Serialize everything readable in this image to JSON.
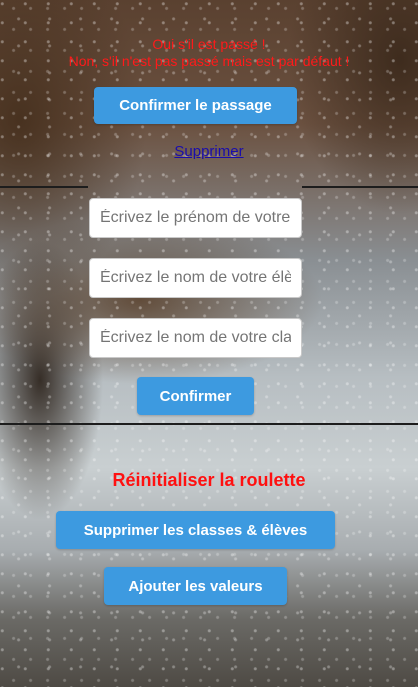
{
  "passage": {
    "notice_line1": "Oui s'il est passé !",
    "notice_line2": "Non, s'il n'est pas passé mais est par défaut !",
    "confirm_button": "Confirmer le passage",
    "delete_link": "Supprimer"
  },
  "form": {
    "first_name_placeholder": "Écrivez le prénom de votre élève",
    "last_name_placeholder": "Écrivez le nom de votre élève",
    "class_placeholder": "Écrivez le nom de votre classe",
    "confirm_button": "Confirmer"
  },
  "reset": {
    "title": "Réinitialiser la roulette",
    "delete_button": "Supprimer les classes & élèves",
    "add_values_button": "Ajouter les valeurs"
  },
  "colors": {
    "accent": "#3d9ae0",
    "alert": "#ff1a1a",
    "link": "#1a0dab"
  }
}
